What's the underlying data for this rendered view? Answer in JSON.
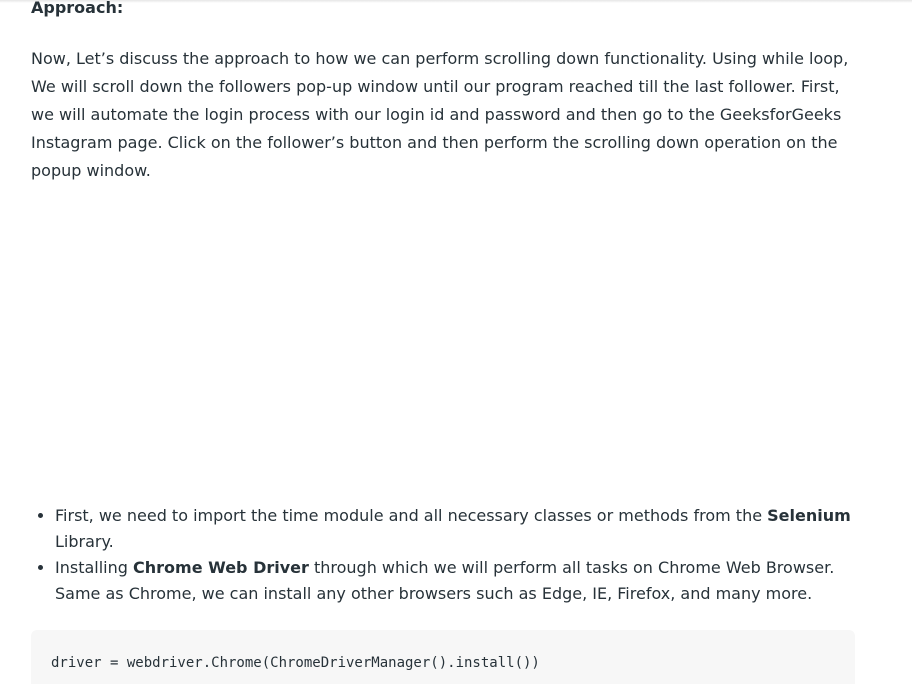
{
  "heading": "Approach:",
  "paragraph": "Now, Let’s discuss the approach to how we can perform scrolling down functionality. Using while loop, We will scroll down the followers pop-up window until our program reached till the last follower. First, we will automate the login process with our login id and password and then go to the GeeksforGeeks Instagram page. Click on the follower’s button and then perform the scrolling down operation on the popup window.",
  "bullets": [
    {
      "before": "First, we need to import the time module and all necessary classes or methods from the ",
      "bold": "Selenium",
      "after": " Library."
    },
    {
      "before": "Installing ",
      "bold": "Chrome Web Driver",
      "after": " through which we will perform all tasks on Chrome Web Browser. Same as Chrome, we can install any other browsers such as Edge, IE, Firefox, and many more."
    }
  ],
  "code": "driver = webdriver.Chrome(ChromeDriverManager().install())"
}
